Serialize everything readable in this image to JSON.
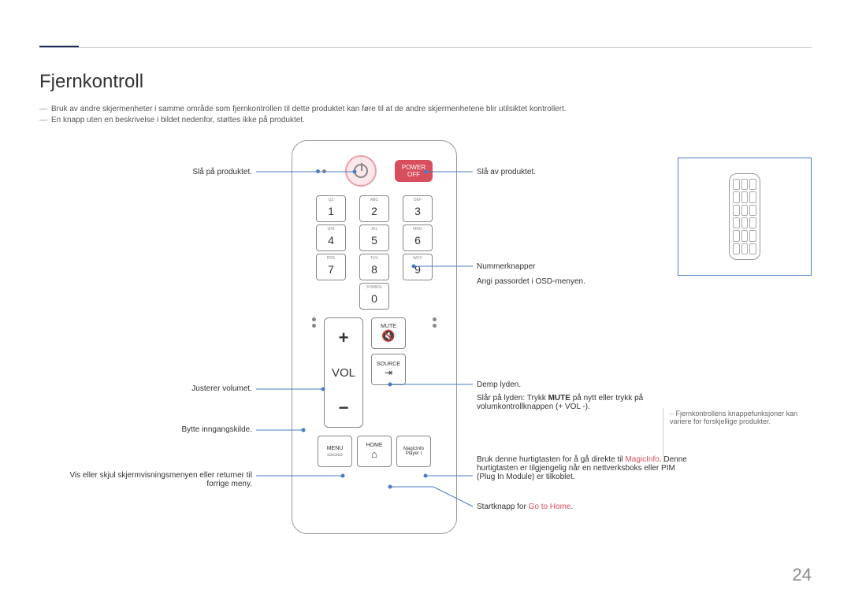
{
  "title": "Fjernkontroll",
  "notes": [
    "Bruk av andre skjermenheter i samme område som fjernkontrollen til dette produktet kan føre til at de andre skjermenhetene blir utilsiktet kontrollert.",
    "En knapp uten en beskrivelse i bildet nedenfor, støttes ikke på produktet."
  ],
  "labels": {
    "power_on": "Slå på produktet.",
    "power_off": "Slå av produktet.",
    "number_title": "Nummerknapper",
    "number_desc": "Angi passordet i OSD-menyen.",
    "volume": "Justerer volumet.",
    "source": "Bytte inngangskilde.",
    "menu": "Vis eller skjul skjermvisningsmenyen eller returner til forrige meny.",
    "mute_title": "Demp lyden.",
    "mute_desc_pre": "Slår på lyden: Trykk ",
    "mute_bold": "MUTE",
    "mute_desc_post": " på nytt eller trykk på volumkontrollknappen (+ VOL -).",
    "magic_pre": "Bruk denne hurtigtasten for å gå direkte til ",
    "magic_hl": "MagicInfo",
    "magic_post": ". Denne hurtigtasten er tilgjengelig når en nettverksboks eller PIM (Plug In Module) er tilkoblet.",
    "home_pre": "Startknapp for ",
    "home_hl": "Go to Home",
    "home_post": "."
  },
  "remote": {
    "power_off_label1": "POWER",
    "power_off_label2": "OFF",
    "keys": [
      {
        "sub": "QZ",
        "num": "1"
      },
      {
        "sub": "ABC",
        "num": "2"
      },
      {
        "sub": "DEF",
        "num": "3"
      },
      {
        "sub": "GHI",
        "num": "4"
      },
      {
        "sub": "JKL",
        "num": "5"
      },
      {
        "sub": "MNO",
        "num": "6"
      },
      {
        "sub": "PRS",
        "num": "7"
      },
      {
        "sub": "TUV",
        "num": "8"
      },
      {
        "sub": "WXY",
        "num": "9"
      }
    ],
    "symbol": "SYMBOL",
    "zero": "0",
    "vol": "VOL",
    "mute": "MUTE",
    "source": "SOURCE",
    "menu": "MENU",
    "home": "HOME",
    "magic1": "MagicInfo",
    "magic2": "Player I"
  },
  "sidenote": "Fjernkontrollens knappefunksjoner kan variere for forskjellige produkter.",
  "page_num": "24"
}
